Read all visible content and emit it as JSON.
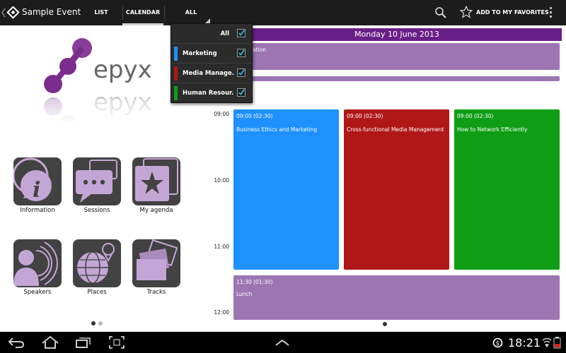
{
  "actionbar": {
    "title": "Sample Event",
    "tabs": [
      {
        "label": "LIST",
        "selected": false
      },
      {
        "label": "CALENDAR",
        "selected": true
      },
      {
        "label": "ALL",
        "selected": false
      }
    ],
    "favorites_label": "ADD TO MY FAVORITES",
    "icons": [
      "app-logo-icon",
      "search-icon",
      "star-icon",
      "overflow-menu-icon"
    ]
  },
  "logo": {
    "text": "epyx"
  },
  "tiles": [
    {
      "label": "Information",
      "icon": "info-icon"
    },
    {
      "label": "Sessions",
      "icon": "chat-icon"
    },
    {
      "label": "My agenda",
      "icon": "star-icon"
    },
    {
      "label": "Speakers",
      "icon": "speaker-icon"
    },
    {
      "label": "Places",
      "icon": "globe-pin-icon"
    },
    {
      "label": "Tracks",
      "icon": "tracks-icon"
    }
  ],
  "dropdown": {
    "items": [
      {
        "label": "All",
        "checked": true
      },
      {
        "label": "Marketing",
        "checked": true,
        "color": "#1e90ff"
      },
      {
        "label": "Media Manage...",
        "checked": true,
        "color": "#b01818"
      },
      {
        "label": "Human Resour...",
        "checked": true,
        "color": "#0f9d16"
      }
    ]
  },
  "calendar": {
    "date": "Monday 10 June 2013",
    "allday_partial_text": "ation",
    "hours": [
      "09:00",
      "10:00",
      "11:00",
      "12:00"
    ],
    "events": [
      {
        "time": "09:00 (02:30)",
        "title": "Business Ethics and Marketing",
        "color": "#1e90ff"
      },
      {
        "time": "09:00 (02:30)",
        "title": "Cross-functional Media Management",
        "color": "#b01818"
      },
      {
        "time": "09:00 (02:30)",
        "title": "How to Network Efficiently",
        "color": "#0f9d16"
      },
      {
        "time": "11:30 (01:30)",
        "title": "Lunch",
        "color": "#9e75b3"
      }
    ],
    "allday_color": "#9e75b3"
  },
  "colors": {
    "accent": "#6a1f88",
    "tile_bg": "#424242",
    "tile_fg": "#c4a6d6",
    "check": "#33b5e5"
  },
  "system": {
    "clock": "18:21"
  }
}
